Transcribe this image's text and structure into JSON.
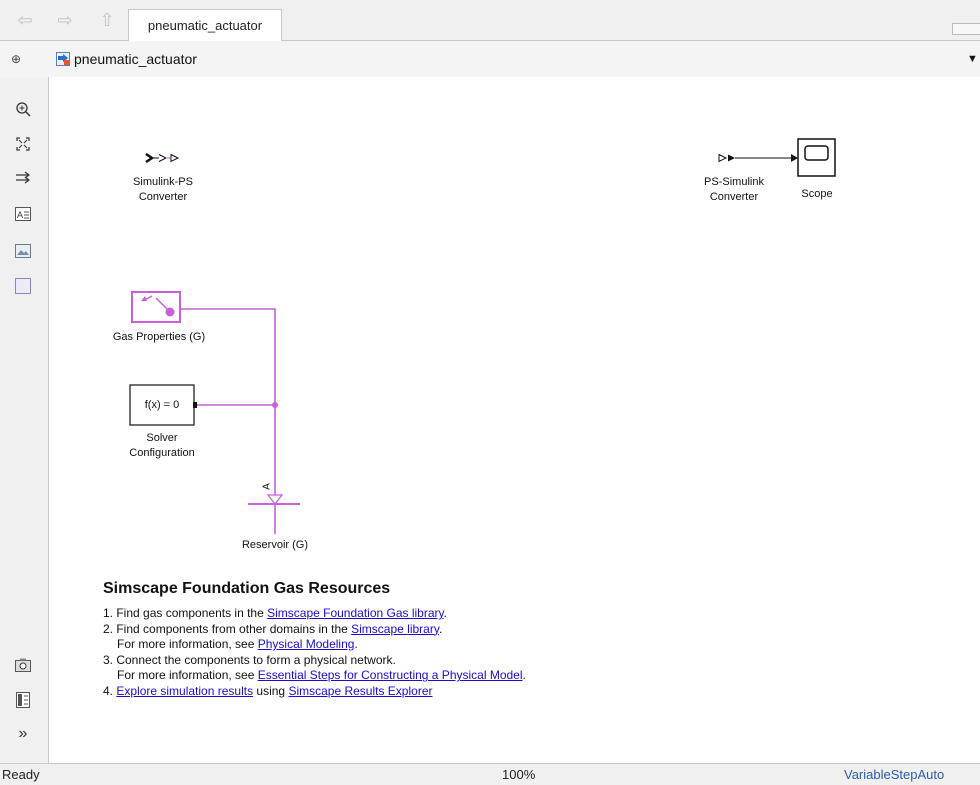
{
  "tab": {
    "label": "pneumatic_actuator"
  },
  "address": {
    "model_name": "pneumatic_actuator"
  },
  "blocks": {
    "simulink_ps": {
      "line1": "Simulink-PS",
      "line2": "Converter"
    },
    "ps_simulink": {
      "line1": "PS-Simulink",
      "line2": "Converter"
    },
    "scope": {
      "label": "Scope"
    },
    "gas_properties": {
      "label": "Gas Properties (G)"
    },
    "solver": {
      "text": "f(x) = 0",
      "line1": "Solver",
      "line2": "Configuration"
    },
    "reservoir": {
      "label": "Reservoir (G)",
      "port": "A"
    }
  },
  "resources": {
    "title": "Simscape Foundation Gas Resources",
    "l1_pre": "1. Find gas components in the ",
    "l1_link": "Simscape Foundation Gas library",
    "l1_post": ".",
    "l2_pre": "2. Find components from other domains in the ",
    "l2_link": "Simscape library",
    "l2_post": ".",
    "l2b_pre": "For more information, see ",
    "l2b_link": "Physical Modeling",
    "l2b_post": ".",
    "l3": "3. Connect the components to form a physical network.",
    "l3b_pre": "For more information, see ",
    "l3b_link": "Essential Steps for Constructing a Physical Model",
    "l3b_post": ".",
    "l4_pre": "4. ",
    "l4_link1": "Explore simulation results",
    "l4_mid": " using ",
    "l4_link2": "Simscape Results Explorer"
  },
  "status": {
    "state": "Ready",
    "zoom": "100%",
    "solver": "VariableStepAuto"
  },
  "colors": {
    "physical_line": "#c462d6",
    "link": "#1a0dcc"
  }
}
